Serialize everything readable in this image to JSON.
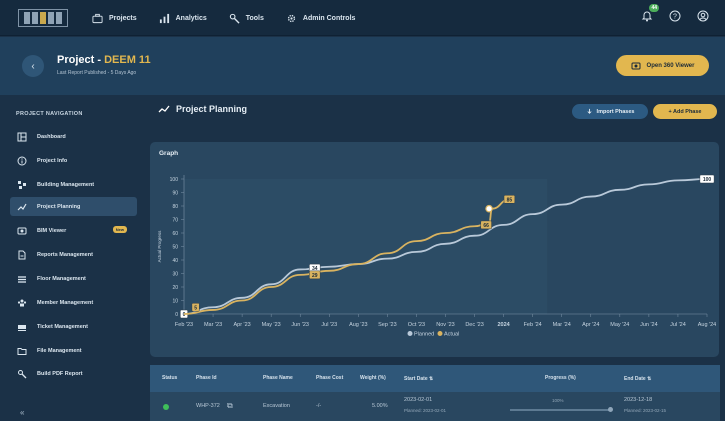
{
  "topbar": {
    "nav": [
      {
        "label": "Projects",
        "icon": "briefcase-icon"
      },
      {
        "label": "Analytics",
        "icon": "bar-chart-icon"
      },
      {
        "label": "Tools",
        "icon": "wrench-icon"
      },
      {
        "label": "Admin Controls",
        "icon": "gear-icon"
      }
    ],
    "notification_count": "44"
  },
  "header": {
    "title_prefix": "Project",
    "title_sep": "-",
    "project_name": "DEEM 11",
    "subtitle": "Last Report Published  -  5 Days Ago",
    "open360_label": "Open 360 Viewer"
  },
  "sidebar": {
    "heading": "PROJECT NAVIGATION",
    "items": [
      {
        "label": "Dashboard",
        "icon": "dashboard-icon"
      },
      {
        "label": "Project Info",
        "icon": "info-icon"
      },
      {
        "label": "Building Management",
        "icon": "building-icon"
      },
      {
        "label": "Project Planning",
        "icon": "trend-line-icon"
      },
      {
        "label": "BIM Viewer",
        "icon": "bim-viewer-icon",
        "badge": "New"
      },
      {
        "label": "Reports Management",
        "icon": "report-icon"
      },
      {
        "label": "Floor Management",
        "icon": "floor-icon"
      },
      {
        "label": "Member Management",
        "icon": "members-icon"
      },
      {
        "label": "Ticket Management",
        "icon": "ticket-icon"
      },
      {
        "label": "File Management",
        "icon": "folder-icon"
      },
      {
        "label": "Build PDF Report",
        "icon": "pdf-tool-icon"
      }
    ],
    "collapse_label": "«"
  },
  "main": {
    "title": "Project Planning",
    "import_label": "Import Phases",
    "add_label": "+ Add Phase",
    "graph_label": "Graph"
  },
  "chart_data": {
    "type": "line",
    "ylabel": "Actual Progress",
    "ylim": [
      0,
      100
    ],
    "yticks": [
      "0",
      "10",
      "20",
      "30",
      "40",
      "50",
      "60",
      "70",
      "80",
      "90",
      "100"
    ],
    "x_tick_labels": [
      "Feb '23",
      "Mar '23",
      "Apr '23",
      "May '23",
      "Jun '23",
      "Jul '23",
      "Aug '23",
      "Sep '23",
      "Oct '23",
      "Nov '23",
      "Dec '23",
      "2024",
      "Feb '24",
      "Mar '24",
      "Apr '24",
      "May '24",
      "Jun '24",
      "Jul '24",
      "Aug '24"
    ],
    "series": [
      {
        "name": "Planned",
        "color": "#b9c9d9",
        "x": [
          0,
          1,
          2,
          3,
          4,
          5,
          6,
          7,
          8,
          9,
          10,
          11,
          12,
          13,
          14,
          15,
          16,
          17,
          18
        ],
        "values": [
          0,
          5,
          12,
          22,
          33,
          35,
          37,
          41,
          46,
          52,
          58,
          66,
          74,
          81,
          87,
          92,
          96,
          99,
          100
        ],
        "labels": [
          {
            "x": 0,
            "y": 0,
            "text": "0"
          },
          {
            "x": 4.5,
            "y": 34,
            "text": "34"
          },
          {
            "x": 18,
            "y": 100,
            "text": "100"
          }
        ]
      },
      {
        "name": "Actual",
        "color": "#d9b360",
        "x": [
          0,
          1,
          2,
          3,
          4,
          5,
          6,
          7,
          8,
          9,
          10,
          10.5,
          10.6,
          11.2
        ],
        "values": [
          0,
          3,
          10,
          20,
          29,
          32,
          37,
          45,
          54,
          60,
          65,
          67,
          78,
          85
        ],
        "labels": [
          {
            "x": 0.4,
            "y": 5,
            "text": "5"
          },
          {
            "x": 4.5,
            "y": 29,
            "text": "29"
          },
          {
            "x": 10.4,
            "y": 66,
            "text": "66"
          },
          {
            "x": 11.2,
            "y": 85,
            "text": "85"
          }
        ]
      }
    ],
    "legend": [
      "Planned",
      "Actual"
    ],
    "legend_position": "bottom-center",
    "grid": false
  },
  "table": {
    "headers": [
      "Status",
      "Phase Id",
      "Phase Name",
      "Phase Cost",
      "Weight (%)",
      "Start Date",
      "Progress (%)",
      "End Date"
    ],
    "rows": [
      {
        "phase_id": "WHP-372",
        "phase_name": "Excavation",
        "phase_cost": "-/-",
        "weight": "5.00%",
        "start_date": "2023-02-01",
        "start_planned": "Planned: 2023-02-01",
        "progress": "100%",
        "end_date": "2023-12-18",
        "end_planned": "Planned: 2023-02-15"
      }
    ]
  }
}
